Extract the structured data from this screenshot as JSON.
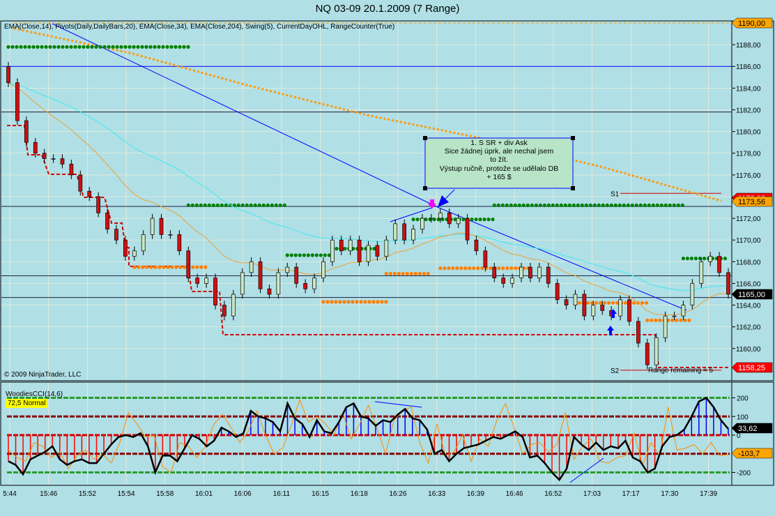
{
  "title": "NQ 03-09  20.1.2009 (7 Range)",
  "indicators_label": "EMA(Close,14), Pivots(Daily,DailyBars,20), EMA(Close,34), EMA(Close,204), Swing(5), CurrentDayOHL, RangeCounter(True)",
  "copyright": "© 2009 NinjaTrader, LLC",
  "range_remaining": "Range remaining = 5",
  "annotation": "1. S SR + div Ask\nSice žádnej úprk, ale nechal jsem\nto žít.\nVýstup ručně, protože se udělalo DB\n+ 165 $",
  "pivot_labels": {
    "s1": "S1",
    "s2": "S2"
  },
  "colors": {
    "background": "#b0dfe6",
    "up": "#c9e8c4",
    "down": "#d01010",
    "ema14": "#f0a030",
    "ema34": "#40e8f0",
    "ema204": "#ff9900",
    "swing_high": "#008000",
    "swing_low": "#ff7f00",
    "trendline": "#0000ff",
    "cci": "#000000",
    "turbo_cci": "#ff8c00"
  },
  "price_tags": {
    "top": "1190,00",
    "s1_hidden": "1173,92",
    "ema204": "1173,56",
    "last": "1165,00",
    "low": "1158,25"
  },
  "cci_panel": {
    "name": "WoodiesCCI(14,6)",
    "status": "72,5 Normal",
    "axis": [
      "200",
      "100",
      "0",
      "-200"
    ],
    "cci_tag": "33,62",
    "turbo_tag": "-103,7"
  },
  "chart_data": {
    "type": "candlestick",
    "title": "NQ 03-09  20.1.2009 (7 Range)",
    "x_ticks": [
      "5:44",
      "15:46",
      "15:52",
      "15:54",
      "15:58",
      "16:01",
      "16:06",
      "16:11",
      "16:15",
      "16:18",
      "16:26",
      "16:33",
      "16:39",
      "16:46",
      "16:52",
      "17:03",
      "17:17",
      "17:30",
      "17:39"
    ],
    "y_ticks": [
      "1188,00",
      "1186,00",
      "1184,00",
      "1182,00",
      "1180,00",
      "1178,00",
      "1176,00",
      "1174,00",
      "1172,00",
      "1170,00",
      "1168,00",
      "1166,00",
      "1164,00",
      "1162,00",
      "1160,00"
    ],
    "ylim": [
      1157,
      1190.5
    ],
    "closes": [
      1184.5,
      1181,
      1179,
      1178,
      1177.5,
      1177.5,
      1177,
      1176,
      1174.5,
      1174,
      1172.5,
      1171,
      1170,
      1168.5,
      1169,
      1170.5,
      1172,
      1170.5,
      1170.5,
      1169,
      1166.5,
      1166,
      1166.5,
      1164,
      1163,
      1165,
      1167,
      1168,
      1165.5,
      1165,
      1167,
      1167.5,
      1166,
      1165.5,
      1166.5,
      1168,
      1170,
      1169,
      1170,
      1168,
      1169.5,
      1168.5,
      1170,
      1171.5,
      1170,
      1171,
      1172,
      1172,
      1172.5,
      1171.5,
      1172,
      1170,
      1169,
      1167.5,
      1166.5,
      1166,
      1166.5,
      1167.5,
      1166.5,
      1167.5,
      1166,
      1164.5,
      1164,
      1165,
      1163,
      1164,
      1163.5,
      1163,
      1164.5,
      1162.5,
      1160.5,
      1158.5,
      1161,
      1163,
      1163,
      1164,
      1166,
      1168,
      1168.5,
      1167,
      1165
    ],
    "ema204": [
      1189.5,
      1187.2,
      1184.2,
      1181.5,
      1179.3,
      1176.7,
      1173.6
    ],
    "pivot_lines": [
      1186,
      1181.8,
      1173.1,
      1166.7,
      1164.7
    ],
    "s1": 1174.3,
    "s2": 1158.0,
    "swing_highs": [
      [
        0,
        20,
        1187.8
      ],
      [
        20,
        31,
        1173.2
      ],
      [
        31,
        36,
        1168.6
      ],
      [
        36,
        41,
        1169.2
      ],
      [
        45,
        54,
        1171.9
      ],
      [
        54,
        75,
        1173.2
      ],
      [
        75,
        85,
        1168.3
      ],
      [
        85,
        92,
        1164.6
      ]
    ],
    "swing_lows": [
      [
        14,
        22,
        1167.5
      ],
      [
        35,
        42,
        1164.3
      ],
      [
        42,
        47,
        1166.9
      ],
      [
        48,
        58,
        1167.4
      ],
      [
        63,
        71,
        1164.2
      ],
      [
        71,
        76,
        1162.6
      ],
      [
        84,
        97,
        1158.25
      ]
    ],
    "cci": [
      -140,
      -160,
      -210,
      -130,
      -110,
      -90,
      -60,
      -130,
      -160,
      -140,
      -130,
      -150,
      -150,
      -100,
      -50,
      -10,
      0,
      -10,
      10,
      -60,
      -200,
      -110,
      -110,
      -140,
      -70,
      0,
      -20,
      -60,
      -30,
      40,
      20,
      -10,
      10,
      130,
      100,
      90,
      70,
      20,
      170,
      90,
      60,
      -10,
      80,
      20,
      10,
      70,
      150,
      170,
      100,
      90,
      50,
      80,
      70,
      110,
      140,
      90,
      80,
      30,
      -100,
      -80,
      -140,
      -100,
      -70,
      -60,
      -50,
      -30,
      -10,
      -20,
      0,
      20,
      -10,
      -120,
      -110,
      -150,
      -200,
      -240,
      -180,
      -10,
      -50,
      -80,
      -40,
      -80,
      -60,
      -70,
      -30,
      -120,
      -140,
      -200,
      -180,
      -60,
      -10,
      0,
      30,
      100,
      180,
      200,
      150,
      80,
      33.62
    ],
    "turbo_cci": [
      -80,
      -120,
      -140,
      -40,
      -60,
      -120,
      -90,
      -180,
      -110,
      -80,
      -130,
      -100,
      -150,
      -40,
      120,
      60,
      -10,
      0,
      -170,
      -200,
      -40,
      -60,
      -120,
      -60,
      60,
      110,
      40,
      -40,
      20,
      130,
      0,
      -100,
      -70,
      50,
      190,
      70,
      100,
      60,
      0,
      120,
      -20,
      60,
      160,
      40,
      -100,
      80,
      130,
      150,
      -40,
      -150,
      60,
      -110,
      -90,
      0,
      -140,
      -20,
      -60,
      80,
      170,
      40,
      -100,
      -50,
      -40,
      -90,
      -50,
      120,
      -130,
      -60,
      -20,
      -140,
      -150,
      -120,
      -110,
      10,
      -160,
      -40,
      -110,
      150,
      -80,
      -70,
      -50,
      -100,
      -40,
      -110,
      -103.7
    ]
  }
}
